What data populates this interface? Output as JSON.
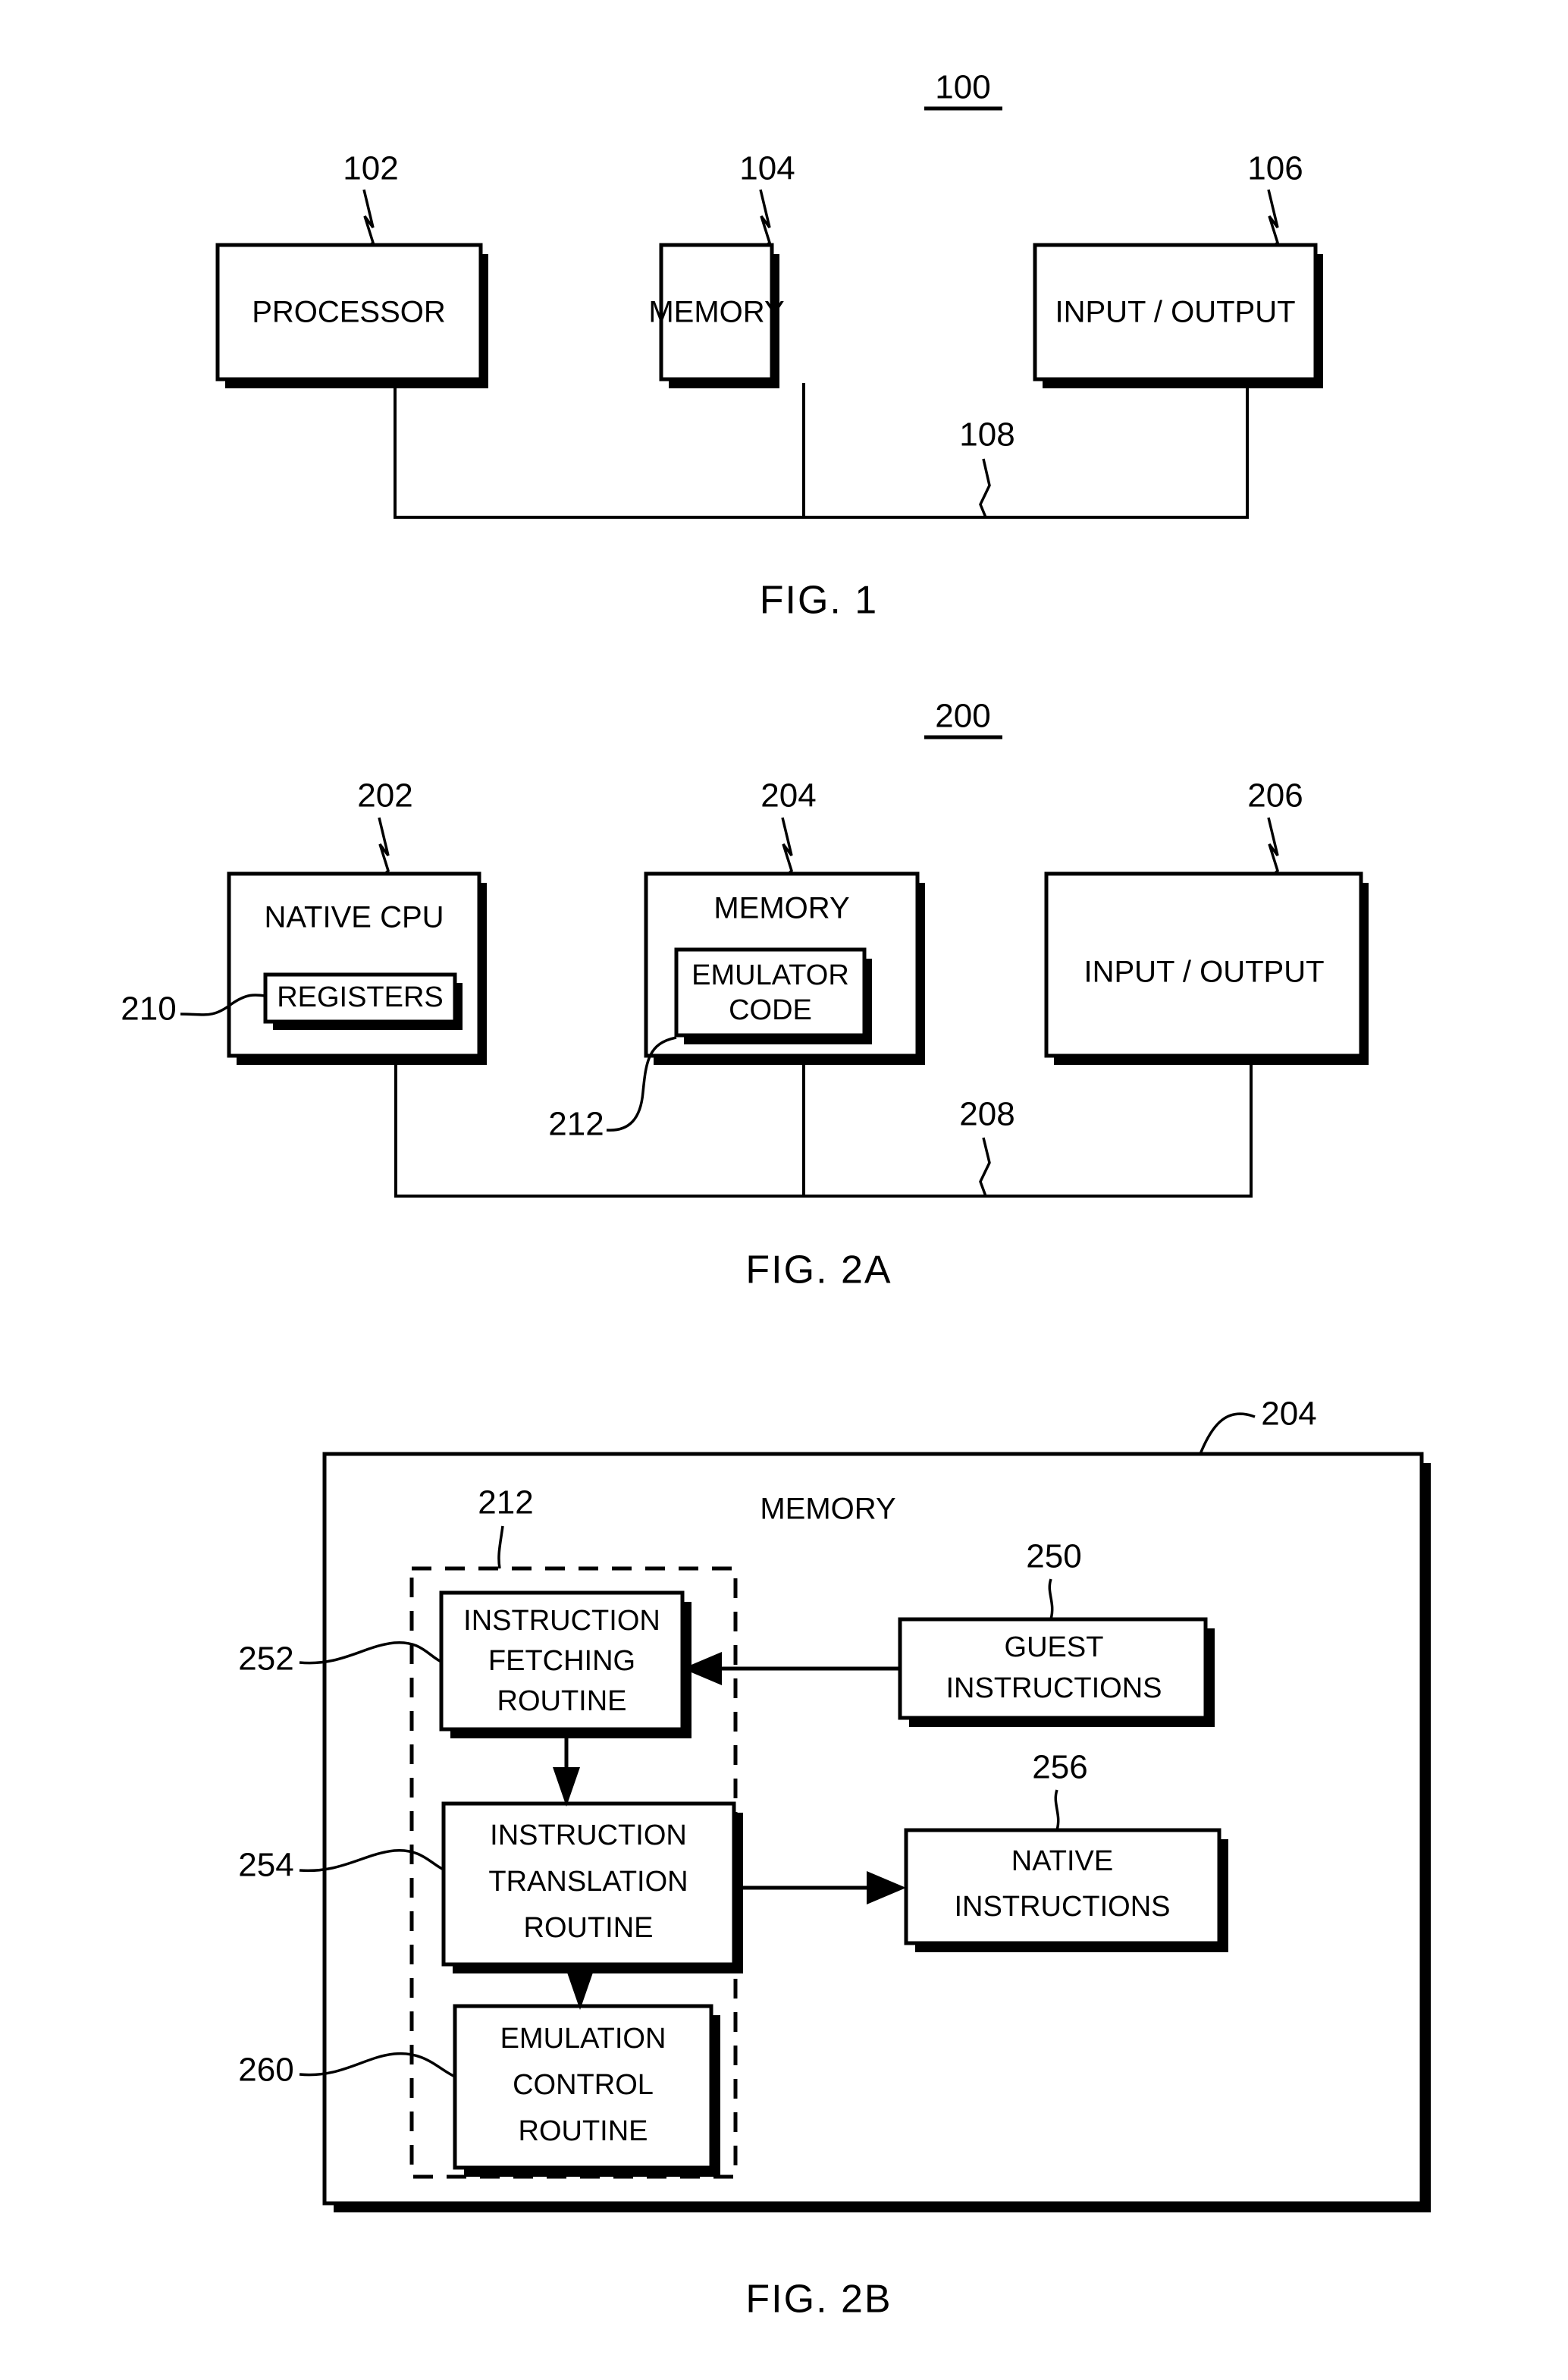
{
  "figures": [
    {
      "id": "fig1",
      "caption": "FIG. 1",
      "system_ref": "100",
      "blocks": [
        {
          "label": "PROCESSOR",
          "ref": "102"
        },
        {
          "label": "MEMORY",
          "ref": "104"
        },
        {
          "label": "INPUT / OUTPUT",
          "ref": "106"
        }
      ],
      "bus_ref": "108"
    },
    {
      "id": "fig2a",
      "caption": "FIG. 2A",
      "system_ref": "200",
      "blocks": [
        {
          "label": "NATIVE CPU",
          "ref": "202",
          "inner_label": "REGISTERS",
          "inner_ref": "210"
        },
        {
          "label": "MEMORY",
          "ref": "204",
          "inner_label_1": "EMULATOR",
          "inner_label_2": "CODE",
          "inner_ref": "212"
        },
        {
          "label": "INPUT / OUTPUT",
          "ref": "206"
        }
      ],
      "bus_ref": "208"
    },
    {
      "id": "fig2b",
      "caption": "FIG. 2B",
      "container_ref": "204",
      "container_title": "MEMORY",
      "emulator_group_ref": "212",
      "routines": [
        {
          "line1": "INSTRUCTION",
          "line2": "FETCHING",
          "line3": "ROUTINE",
          "ref": "252"
        },
        {
          "line1": "INSTRUCTION",
          "line2": "TRANSLATION",
          "line3": "ROUTINE",
          "ref": "254"
        },
        {
          "line1": "EMULATION",
          "line2": "CONTROL",
          "line3": "ROUTINE",
          "ref": "260"
        }
      ],
      "side_blocks": [
        {
          "line1": "GUEST",
          "line2": "INSTRUCTIONS",
          "ref": "250"
        },
        {
          "line1": "NATIVE",
          "line2": "INSTRUCTIONS",
          "ref": "256"
        }
      ]
    }
  ]
}
